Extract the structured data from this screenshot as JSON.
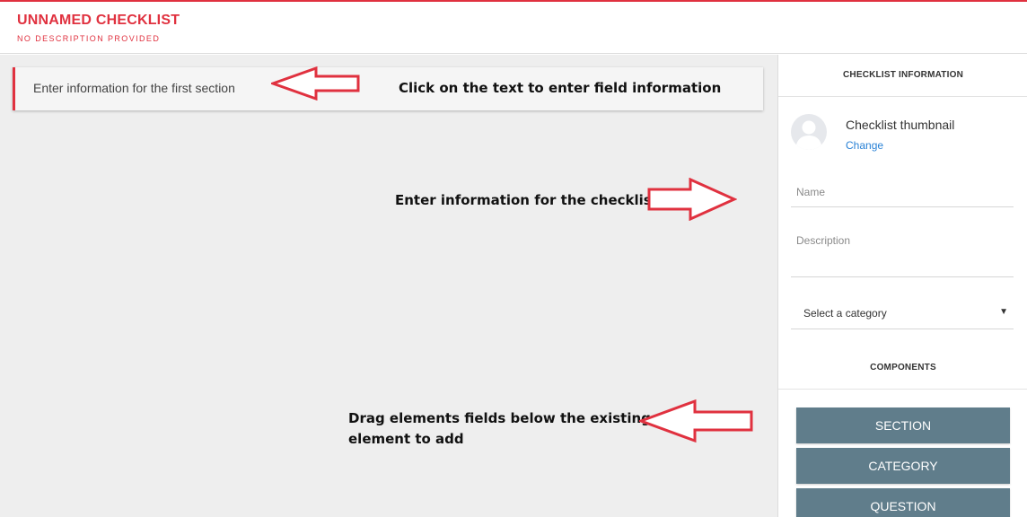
{
  "header": {
    "title": "UNNAMED CHECKLIST",
    "subtitle": "NO DESCRIPTION PROVIDED"
  },
  "canvas": {
    "section_prompt": "Enter information for the first section"
  },
  "annotations": {
    "click_text": "Click on the text to enter field information",
    "checklist_info": "Enter information for the checklist",
    "drag_line1": "Drag elements fields below the existing",
    "drag_line2": "element to add"
  },
  "sidebar": {
    "info_heading": "CHECKLIST INFORMATION",
    "thumbnail_label": "Checklist thumbnail",
    "change_link": "Change",
    "name_placeholder": "Name",
    "description_placeholder": "Description",
    "category_select": "Select a category",
    "components_heading": "COMPONENTS",
    "components": [
      "SECTION",
      "CATEGORY",
      "QUESTION"
    ]
  },
  "colors": {
    "accent": "#e0313f",
    "button": "#607d8b",
    "link": "#2a82d6",
    "canvas_bg": "#eeeeee"
  },
  "icons": {
    "avatar": "user-avatar-icon",
    "caret": "caret-down-icon",
    "arrows": "red-outline-arrow-icon"
  }
}
